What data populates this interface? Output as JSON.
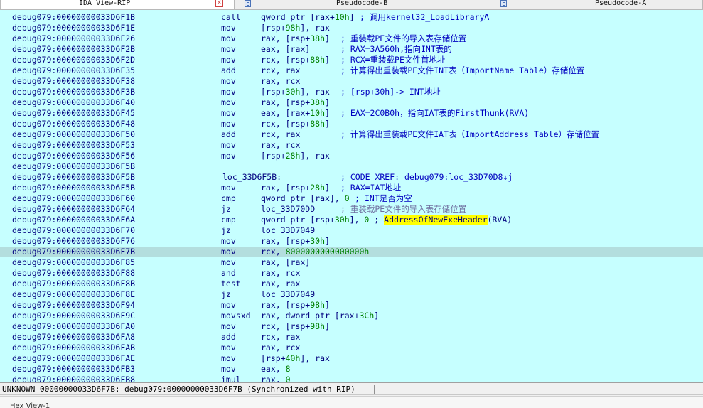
{
  "tabs": [
    {
      "label": "IDA View-RIP",
      "close": "×"
    },
    {
      "label": "Pseudocode-B"
    },
    {
      "label": "Pseudocode-A"
    }
  ],
  "listing": [
    {
      "addr": "debug079:00000000033D6F1B",
      "mn": "call",
      "op": [
        {
          "t": "qword ptr [rax+"
        },
        {
          "t": "10h",
          "c": "num"
        },
        {
          "t": "]"
        }
      ],
      "com": "; 调用kernel32_LoadLibraryA",
      "com_col": 0
    },
    {
      "addr": "debug079:00000000033D6F1E",
      "mn": "mov",
      "op": [
        {
          "t": "[rsp+"
        },
        {
          "t": "98h",
          "c": "num"
        },
        {
          "t": "], rax"
        }
      ]
    },
    {
      "addr": "debug079:00000000033D6F26",
      "mn": "mov",
      "op": [
        {
          "t": "rax, [rsp+"
        },
        {
          "t": "38h",
          "c": "num"
        },
        {
          "t": "]"
        }
      ],
      "com": "; 重装载PE文件的导入表存储位置",
      "com_col": 1
    },
    {
      "addr": "debug079:00000000033D6F2B",
      "mn": "mov",
      "op": [
        {
          "t": "eax, [rax]"
        }
      ],
      "com": "; RAX=3A560h,指向INT表的",
      "com_col": 1
    },
    {
      "addr": "debug079:00000000033D6F2D",
      "mn": "mov",
      "op": [
        {
          "t": "rcx, [rsp+"
        },
        {
          "t": "88h",
          "c": "num"
        },
        {
          "t": "]"
        }
      ],
      "com": "; RCX=重装载PE文件首地址",
      "com_col": 1
    },
    {
      "addr": "debug079:00000000033D6F35",
      "mn": "add",
      "op": [
        {
          "t": "rcx, rax"
        }
      ],
      "com": "; 计算得出重装载PE文件INT表（ImportName Table）存储位置",
      "com_col": 1
    },
    {
      "addr": "debug079:00000000033D6F38",
      "mn": "mov",
      "op": [
        {
          "t": "rax, rcx"
        }
      ]
    },
    {
      "addr": "debug079:00000000033D6F3B",
      "mn": "mov",
      "op": [
        {
          "t": "[rsp+"
        },
        {
          "t": "30h",
          "c": "num"
        },
        {
          "t": "], rax"
        }
      ],
      "com": "; [rsp+30h]-> INT地址",
      "com_col": 1
    },
    {
      "addr": "debug079:00000000033D6F40",
      "mn": "mov",
      "op": [
        {
          "t": "rax, [rsp+"
        },
        {
          "t": "38h",
          "c": "num"
        },
        {
          "t": "]"
        }
      ]
    },
    {
      "addr": "debug079:00000000033D6F45",
      "mn": "mov",
      "op": [
        {
          "t": "eax, [rax+"
        },
        {
          "t": "10h",
          "c": "num"
        },
        {
          "t": "]"
        }
      ],
      "com": "; EAX=2C0B0h，指向IAT表的FirstThunk(RVA)",
      "com_col": 1
    },
    {
      "addr": "debug079:00000000033D6F48",
      "mn": "mov",
      "op": [
        {
          "t": "rcx, [rsp+"
        },
        {
          "t": "88h",
          "c": "num"
        },
        {
          "t": "]"
        }
      ]
    },
    {
      "addr": "debug079:00000000033D6F50",
      "mn": "add",
      "op": [
        {
          "t": "rcx, rax"
        }
      ],
      "com": "; 计算得出重装载PE文件IAT表（ImportAddress Table）存储位置",
      "com_col": 1
    },
    {
      "addr": "debug079:00000000033D6F53",
      "mn": "mov",
      "op": [
        {
          "t": "rax, rcx"
        }
      ]
    },
    {
      "addr": "debug079:00000000033D6F56",
      "mn": "mov",
      "op": [
        {
          "t": "[rsp+"
        },
        {
          "t": "28h",
          "c": "num"
        },
        {
          "t": "], rax"
        }
      ]
    },
    {
      "addr": "debug079:00000000033D6F5B"
    },
    {
      "addr": "debug079:00000000033D6F5B",
      "label": "loc_33D6F5B:",
      "com": "; CODE XREF: debug079:loc_33D70D8↓j",
      "com_col": 1
    },
    {
      "addr": "debug079:00000000033D6F5B",
      "mn": "mov",
      "op": [
        {
          "t": "rax, [rsp+"
        },
        {
          "t": "28h",
          "c": "num"
        },
        {
          "t": "]"
        }
      ],
      "com": "; RAX=IAT地址",
      "com_col": 1
    },
    {
      "addr": "debug079:00000000033D6F60",
      "mn": "cmp",
      "op": [
        {
          "t": "qword ptr [rax], "
        },
        {
          "t": "0",
          "c": "num"
        }
      ],
      "com": "; INT是否为空",
      "com_col": 2
    },
    {
      "addr": "debug079:00000000033D6F64",
      "mn": "jz",
      "op": [
        {
          "t": "loc_33D70DD"
        }
      ],
      "com": "; 重装载PE文件的导入表存储位置",
      "com_col": 1,
      "dim": true
    },
    {
      "addr": "debug079:00000000033D6F6A",
      "mn": "cmp",
      "op": [
        {
          "t": "qword ptr [rsp+"
        },
        {
          "t": "30h",
          "c": "num"
        },
        {
          "t": "], "
        },
        {
          "t": "0",
          "c": "num"
        },
        {
          "t": " ; "
        },
        {
          "t": "AddressOfNewExeHeader",
          "c": "hl"
        },
        {
          "t": "(RVA)"
        }
      ]
    },
    {
      "addr": "debug079:00000000033D6F70",
      "mn": "jz",
      "op": [
        {
          "t": "loc_33D7049"
        }
      ]
    },
    {
      "addr": "debug079:00000000033D6F76",
      "mn": "mov",
      "op": [
        {
          "t": "rax, [rsp+"
        },
        {
          "t": "30h",
          "c": "num"
        },
        {
          "t": "]"
        }
      ]
    },
    {
      "addr": "debug079:00000000033D6F7B",
      "mn": "mov",
      "op": [
        {
          "t": "rcx, "
        },
        {
          "t": "8000000000000000h",
          "c": "num"
        }
      ],
      "current": true
    },
    {
      "addr": "debug079:00000000033D6F85",
      "mn": "mov",
      "op": [
        {
          "t": "rax, [rax]"
        }
      ]
    },
    {
      "addr": "debug079:00000000033D6F88",
      "mn": "and",
      "op": [
        {
          "t": "rax, rcx"
        }
      ]
    },
    {
      "addr": "debug079:00000000033D6F8B",
      "mn": "test",
      "op": [
        {
          "t": "rax, rax"
        }
      ]
    },
    {
      "addr": "debug079:00000000033D6F8E",
      "mn": "jz",
      "op": [
        {
          "t": "loc_33D7049"
        }
      ]
    },
    {
      "addr": "debug079:00000000033D6F94",
      "mn": "mov",
      "op": [
        {
          "t": "rax, [rsp+"
        },
        {
          "t": "98h",
          "c": "num"
        },
        {
          "t": "]"
        }
      ]
    },
    {
      "addr": "debug079:00000000033D6F9C",
      "mn": "movsxd",
      "op": [
        {
          "t": "rax, dword ptr [rax+"
        },
        {
          "t": "3Ch",
          "c": "num"
        },
        {
          "t": "]"
        }
      ]
    },
    {
      "addr": "debug079:00000000033D6FA0",
      "mn": "mov",
      "op": [
        {
          "t": "rcx, [rsp+"
        },
        {
          "t": "98h",
          "c": "num"
        },
        {
          "t": "]"
        }
      ]
    },
    {
      "addr": "debug079:00000000033D6FA8",
      "mn": "add",
      "op": [
        {
          "t": "rcx, rax"
        }
      ]
    },
    {
      "addr": "debug079:00000000033D6FAB",
      "mn": "mov",
      "op": [
        {
          "t": "rax, rcx"
        }
      ]
    },
    {
      "addr": "debug079:00000000033D6FAE",
      "mn": "mov",
      "op": [
        {
          "t": "[rsp+"
        },
        {
          "t": "40h",
          "c": "num"
        },
        {
          "t": "], rax"
        }
      ]
    },
    {
      "addr": "debug079:00000000033D6FB3",
      "mn": "mov",
      "op": [
        {
          "t": "eax, "
        },
        {
          "t": "8",
          "c": "num"
        }
      ]
    },
    {
      "addr": "debug079:00000000033D6FB8",
      "mn": "imul",
      "op": [
        {
          "t": "rax, "
        },
        {
          "t": "0",
          "c": "num"
        }
      ]
    }
  ],
  "status": {
    "text": "UNKNOWN 00000000033D6F7B: debug079:00000000033D6F7B (Synchronized with RIP)"
  },
  "bottom": {
    "text": "Hex View-1"
  }
}
